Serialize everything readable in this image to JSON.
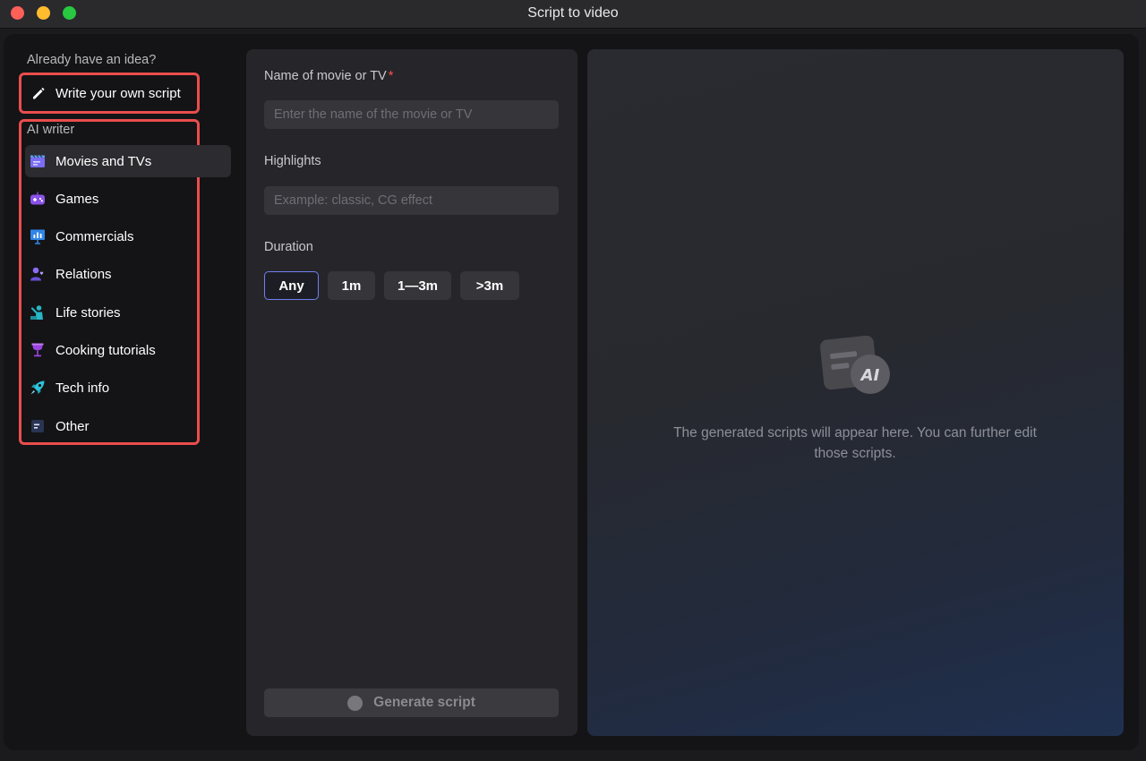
{
  "window": {
    "title": "Script to video"
  },
  "sidebar": {
    "idea_heading": "Already have an idea?",
    "write_own": {
      "label": "Write your own script",
      "icon": "pencil-icon"
    },
    "ai_heading": "AI writer",
    "items": [
      {
        "label": "Movies and TVs",
        "icon": "clapperboard-icon",
        "active": true
      },
      {
        "label": "Games",
        "icon": "gamepad-icon"
      },
      {
        "label": "Commercials",
        "icon": "presentation-chart-icon"
      },
      {
        "label": "Relations",
        "icon": "people-heart-icon"
      },
      {
        "label": "Life stories",
        "icon": "person-waving-icon"
      },
      {
        "label": "Cooking tutorials",
        "icon": "wine-glass-icon"
      },
      {
        "label": "Tech info",
        "icon": "rocket-icon"
      },
      {
        "label": "Other",
        "icon": "document-icon"
      }
    ]
  },
  "form": {
    "name_label": "Name of movie or TV",
    "required_mark": "*",
    "name_placeholder": "Enter the name of the movie or TV",
    "highlights_label": "Highlights",
    "highlights_placeholder": "Example: classic, CG effect",
    "duration_label": "Duration",
    "durations": [
      "Any",
      "1m",
      "1—3m",
      ">3m"
    ],
    "selected_duration": "Any",
    "generate_label": "Generate script"
  },
  "result": {
    "icon_text": "AI",
    "empty_text": "The generated scripts will appear here. You can further edit those scripts."
  },
  "colors": {
    "accent": "#6f7ff0",
    "required": "#ff4d4f",
    "highlight_box": "#ea4d4d"
  }
}
